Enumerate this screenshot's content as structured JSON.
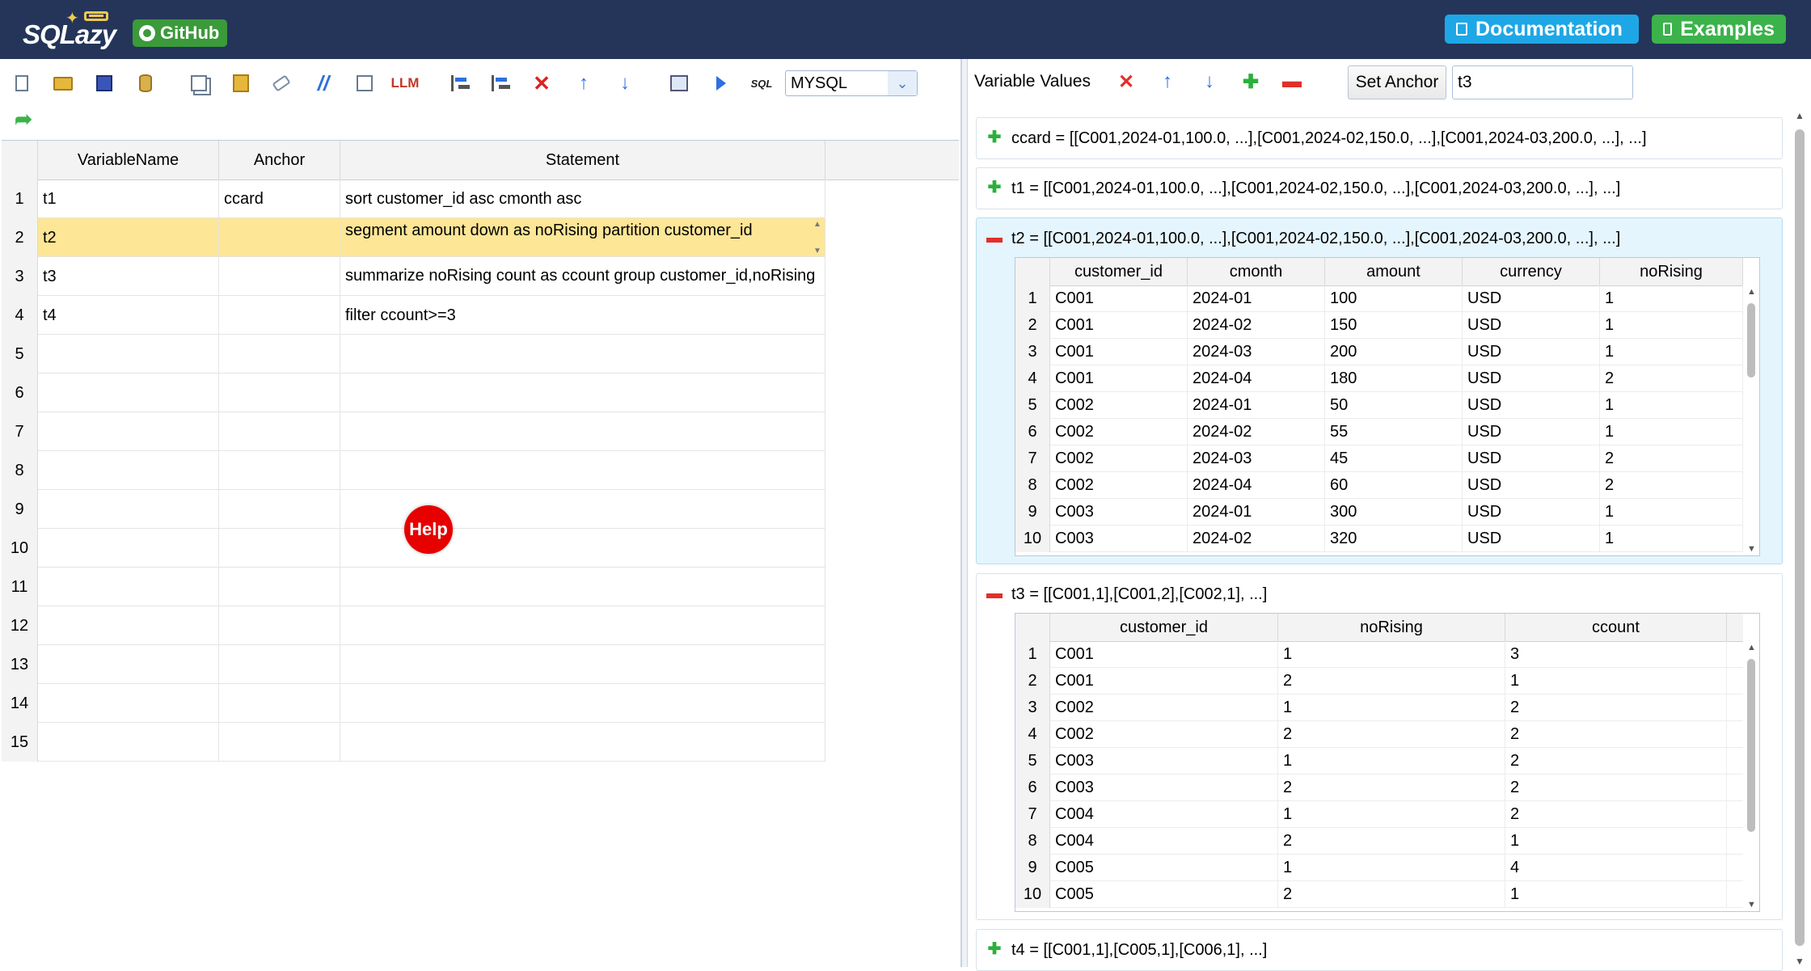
{
  "header": {
    "logo_text": "SQLazy",
    "github_label": "GitHub",
    "documentation_label": "Documentation",
    "examples_label": "Examples"
  },
  "toolbar": {
    "icons": [
      "new-file-icon",
      "open-folder-icon",
      "save-icon",
      "database-icon",
      "copy-icon",
      "paste-icon",
      "eraser-icon",
      "comment-icon",
      "edit-icon",
      "llm-icon",
      "insert-row-icon",
      "insert-child-icon",
      "delete-row-icon",
      "move-up-icon",
      "move-down-icon",
      "preview-icon",
      "run-icon",
      "sql-icon",
      "redo-icon"
    ],
    "llm_label": "LLM",
    "sql_label": "SQL",
    "dialect": "MYSQL"
  },
  "grid": {
    "columns": [
      "VariableName",
      "Anchor",
      "Statement"
    ],
    "rows": [
      {
        "num": "1",
        "variable": "t1",
        "anchor": "ccard",
        "statement": "sort customer_id asc cmonth asc"
      },
      {
        "num": "2",
        "variable": "t2",
        "anchor": "",
        "statement": "segment amount down  as  noRising partition customer_id"
      },
      {
        "num": "3",
        "variable": "t3",
        "anchor": "",
        "statement": "summarize noRising count as ccount group customer_id,noRising"
      },
      {
        "num": "4",
        "variable": "t4",
        "anchor": "",
        "statement": "filter ccount>=3"
      },
      {
        "num": "5",
        "variable": "",
        "anchor": "",
        "statement": ""
      },
      {
        "num": "6",
        "variable": "",
        "anchor": "",
        "statement": ""
      },
      {
        "num": "7",
        "variable": "",
        "anchor": "",
        "statement": ""
      },
      {
        "num": "8",
        "variable": "",
        "anchor": "",
        "statement": ""
      },
      {
        "num": "9",
        "variable": "",
        "anchor": "",
        "statement": ""
      },
      {
        "num": "10",
        "variable": "",
        "anchor": "",
        "statement": ""
      },
      {
        "num": "11",
        "variable": "",
        "anchor": "",
        "statement": ""
      },
      {
        "num": "12",
        "variable": "",
        "anchor": "",
        "statement": ""
      },
      {
        "num": "13",
        "variable": "",
        "anchor": "",
        "statement": ""
      },
      {
        "num": "14",
        "variable": "",
        "anchor": "",
        "statement": ""
      },
      {
        "num": "15",
        "variable": "",
        "anchor": "",
        "statement": ""
      }
    ],
    "selected_row": 2
  },
  "help_label": "Help",
  "variable_values": {
    "title": "Variable Values",
    "set_anchor_label": "Set Anchor",
    "anchor_value": "t3",
    "panels": [
      {
        "label": "ccard = [[C001,2024-01,100.0, ...],[C001,2024-02,150.0, ...],[C001,2024-03,200.0, ...], ...]",
        "expanded": false
      },
      {
        "label": "t1 = [[C001,2024-01,100.0, ...],[C001,2024-02,150.0, ...],[C001,2024-03,200.0, ...], ...]",
        "expanded": false
      },
      {
        "label": "t2 = [[C001,2024-01,100.0, ...],[C001,2024-02,150.0, ...],[C001,2024-03,200.0, ...], ...]",
        "expanded": true,
        "columns": [
          "customer_id",
          "cmonth",
          "amount",
          "currency",
          "noRising"
        ],
        "rows": [
          [
            "1",
            "C001",
            "2024-01",
            "100",
            "USD",
            "1"
          ],
          [
            "2",
            "C001",
            "2024-02",
            "150",
            "USD",
            "1"
          ],
          [
            "3",
            "C001",
            "2024-03",
            "200",
            "USD",
            "1"
          ],
          [
            "4",
            "C001",
            "2024-04",
            "180",
            "USD",
            "2"
          ],
          [
            "5",
            "C002",
            "2024-01",
            "50",
            "USD",
            "1"
          ],
          [
            "6",
            "C002",
            "2024-02",
            "55",
            "USD",
            "1"
          ],
          [
            "7",
            "C002",
            "2024-03",
            "45",
            "USD",
            "2"
          ],
          [
            "8",
            "C002",
            "2024-04",
            "60",
            "USD",
            "2"
          ],
          [
            "9",
            "C003",
            "2024-01",
            "300",
            "USD",
            "1"
          ],
          [
            "10",
            "C003",
            "2024-02",
            "320",
            "USD",
            "1"
          ]
        ]
      },
      {
        "label": "t3 = [[C001,1],[C001,2],[C002,1], ...]",
        "expanded": true,
        "columns": [
          "customer_id",
          "noRising",
          "ccount"
        ],
        "rows": [
          [
            "1",
            "C001",
            "1",
            "3"
          ],
          [
            "2",
            "C001",
            "2",
            "1"
          ],
          [
            "3",
            "C002",
            "1",
            "2"
          ],
          [
            "4",
            "C002",
            "2",
            "2"
          ],
          [
            "5",
            "C003",
            "1",
            "2"
          ],
          [
            "6",
            "C003",
            "2",
            "2"
          ],
          [
            "7",
            "C004",
            "1",
            "2"
          ],
          [
            "8",
            "C004",
            "2",
            "1"
          ],
          [
            "9",
            "C005",
            "1",
            "4"
          ],
          [
            "10",
            "C005",
            "2",
            "1"
          ]
        ]
      },
      {
        "label": "t4 = [[C001,1],[C005,1],[C006,1], ...]",
        "expanded": false
      }
    ]
  }
}
